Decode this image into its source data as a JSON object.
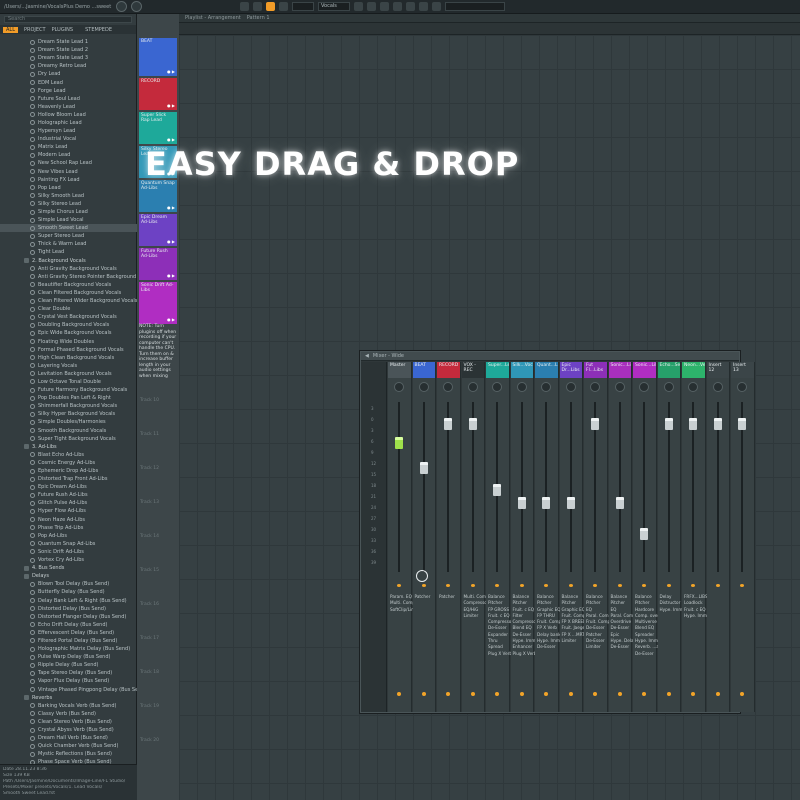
{
  "topbar": {
    "path": "/Users/...Jasmine/VocalsPlus Demo ...sweet Sweet Lead Hit...",
    "pattern_label": "Vocals",
    "accent": "#f29c28"
  },
  "browser": {
    "search_placeholder": "Search",
    "tabs": [
      "ALL",
      "PROJECT",
      "PLUGINS",
      "",
      "STEMPEDE"
    ],
    "items": [
      {
        "label": "Dream State Lead 1",
        "type": "preset"
      },
      {
        "label": "Dream State Lead 2",
        "type": "preset"
      },
      {
        "label": "Dream State Lead 3",
        "type": "preset"
      },
      {
        "label": "Dreamy Retro Lead",
        "type": "preset"
      },
      {
        "label": "Dry Lead",
        "type": "preset"
      },
      {
        "label": "EDM Lead",
        "type": "preset"
      },
      {
        "label": "Forge Lead",
        "type": "preset"
      },
      {
        "label": "Future Soul Lead",
        "type": "preset"
      },
      {
        "label": "Heavenly Lead",
        "type": "preset"
      },
      {
        "label": "Hollow Bloom Lead",
        "type": "preset"
      },
      {
        "label": "Holographic Lead",
        "type": "preset"
      },
      {
        "label": "Hypersyn Lead",
        "type": "preset"
      },
      {
        "label": "Industrial Vocal",
        "type": "preset"
      },
      {
        "label": "Matrix Lead",
        "type": "preset"
      },
      {
        "label": "Modern Lead",
        "type": "preset"
      },
      {
        "label": "New School Rap Lead",
        "type": "preset"
      },
      {
        "label": "New Vibes Lead",
        "type": "preset"
      },
      {
        "label": "Painting FX Lead",
        "type": "preset"
      },
      {
        "label": "Pop Lead",
        "type": "preset"
      },
      {
        "label": "Silky Smooth Lead",
        "type": "preset"
      },
      {
        "label": "Silky Stereo Lead",
        "type": "preset"
      },
      {
        "label": "Simple Chorus Lead",
        "type": "preset"
      },
      {
        "label": "Simple Lead Vocal",
        "type": "preset"
      },
      {
        "label": "Smooth Sweet Lead",
        "type": "preset",
        "selected": true
      },
      {
        "label": "Super Stereo Lead",
        "type": "preset"
      },
      {
        "label": "Thick & Warm Lead",
        "type": "preset"
      },
      {
        "label": "Tight Lead",
        "type": "preset"
      },
      {
        "label": "2. Background Vocals",
        "type": "folder"
      },
      {
        "label": "Anti Gravity Background Vocals",
        "type": "preset"
      },
      {
        "label": "Anti Gravity Stereo Pointer Background Vocals",
        "type": "preset"
      },
      {
        "label": "Beautifier Background Vocals",
        "type": "preset"
      },
      {
        "label": "Clean Filtered Background Vocals",
        "type": "preset"
      },
      {
        "label": "Clean Filtered Wider Background Vocals",
        "type": "preset"
      },
      {
        "label": "Clear Double",
        "type": "preset"
      },
      {
        "label": "Crystal Vest Background Vocals",
        "type": "preset"
      },
      {
        "label": "Doubling Background Vocals",
        "type": "preset"
      },
      {
        "label": "Epic Wide Background Vocals",
        "type": "preset"
      },
      {
        "label": "Floating Wide Doubles",
        "type": "preset"
      },
      {
        "label": "Formal Phased Background Vocals",
        "type": "preset"
      },
      {
        "label": "High Clean Background Vocals",
        "type": "preset"
      },
      {
        "label": "Layering Vocals",
        "type": "preset"
      },
      {
        "label": "Levitation Background Vocals",
        "type": "preset"
      },
      {
        "label": "Low Octave Tonal Double",
        "type": "preset"
      },
      {
        "label": "Future Harmony Background Vocals",
        "type": "preset"
      },
      {
        "label": "Pop Doubles Pan Left & Right",
        "type": "preset"
      },
      {
        "label": "Shimmerfall Background Vocals",
        "type": "preset"
      },
      {
        "label": "Silky Hyper Background Vocals",
        "type": "preset"
      },
      {
        "label": "Simple Doubles/Harmonies",
        "type": "preset"
      },
      {
        "label": "Smooth Background Vocals",
        "type": "preset"
      },
      {
        "label": "Super Tight Background Vocals",
        "type": "preset"
      },
      {
        "label": "3. Ad-Libs",
        "type": "folder"
      },
      {
        "label": "Blast Echo Ad-Libs",
        "type": "preset"
      },
      {
        "label": "Cosmic Energy Ad-Libs",
        "type": "preset"
      },
      {
        "label": "Ephemeric Drop Ad-Libs",
        "type": "preset"
      },
      {
        "label": "Distorted Trap Front Ad-Libs",
        "type": "preset"
      },
      {
        "label": "Epic Dream Ad-Libs",
        "type": "preset"
      },
      {
        "label": "Future Rush Ad-Libs",
        "type": "preset"
      },
      {
        "label": "Glitch Pulse Ad-Libs",
        "type": "preset"
      },
      {
        "label": "Hyper Flow Ad-Libs",
        "type": "preset"
      },
      {
        "label": "Neon Haze Ad-Libs",
        "type": "preset"
      },
      {
        "label": "Phase Trip Ad-Libs",
        "type": "preset"
      },
      {
        "label": "Pop Ad-Libs",
        "type": "preset"
      },
      {
        "label": "Quantum Snap Ad-Libs",
        "type": "preset"
      },
      {
        "label": "Sonic Drift Ad-Libs",
        "type": "preset"
      },
      {
        "label": "Vortex Cry Ad-Libs",
        "type": "preset"
      },
      {
        "label": "4. Bus Sends",
        "type": "folder"
      },
      {
        "label": "Delays",
        "type": "folder"
      },
      {
        "label": "Blown Tool Delay (Bus Send)",
        "type": "preset"
      },
      {
        "label": "Butterfly Delay (Bus Send)",
        "type": "preset"
      },
      {
        "label": "Delay Bank Left & Right (Bus Send)",
        "type": "preset"
      },
      {
        "label": "Distorted Delay (Bus Send)",
        "type": "preset"
      },
      {
        "label": "Distorted Flanger Delay (Bus Send)",
        "type": "preset"
      },
      {
        "label": "Echo Drift Delay (Bus Send)",
        "type": "preset"
      },
      {
        "label": "Effervescent Delay (Bus Send)",
        "type": "preset"
      },
      {
        "label": "Filtered Portal Delay (Bus Send)",
        "type": "preset"
      },
      {
        "label": "Holographic Matrix Delay (Bus Send)",
        "type": "preset"
      },
      {
        "label": "Pulse Warp Delay (Bus Send)",
        "type": "preset"
      },
      {
        "label": "Ripple Delay (Bus Send)",
        "type": "preset"
      },
      {
        "label": "Tape Stereo Delay (Bus Send)",
        "type": "preset"
      },
      {
        "label": "Vapor Flux Delay (Bus Send)",
        "type": "preset"
      },
      {
        "label": "Vintage Phased Pingpong Delay (Bus Send)",
        "type": "preset"
      },
      {
        "label": "Reverbs",
        "type": "folder"
      },
      {
        "label": "Barking Vocals Verb (Bus Send)",
        "type": "preset"
      },
      {
        "label": "Classy Verb (Bus Send)",
        "type": "preset"
      },
      {
        "label": "Clean Stereo Verb (Bus Send)",
        "type": "preset"
      },
      {
        "label": "Crystal Abyss Verb (Bus Send)",
        "type": "preset"
      },
      {
        "label": "Dream Hall Verb (Bus Send)",
        "type": "preset"
      },
      {
        "label": "Quick Chamber Verb (Bus Send)",
        "type": "preset"
      },
      {
        "label": "Mystic Reflections (Bus Send)",
        "type": "preset"
      },
      {
        "label": "Phase Space Verb (Bus Send)",
        "type": "preset"
      }
    ],
    "info": [
      "Date  28.11.23 8:36",
      "Size  139 KB",
      "Path  /Users/Jasmine/Documents/Image-Line/FL Studio/",
      "      Presets/Mixer presets/Vocals/1. Lead Vocals/",
      "      Smooth Sweet Lead.fst"
    ]
  },
  "tracks": {
    "clips": [
      {
        "label": "BEAT",
        "color": "#3a66d1"
      },
      {
        "label": "RECORD",
        "color": "#c42a3c"
      },
      {
        "label": "Super Slick Rap Lead",
        "color": "#1ea99a"
      },
      {
        "label": "Silky Stereo Lead",
        "color": "#2f97b7"
      },
      {
        "label": "Quantum Snap Ad-Libs",
        "color": "#2b7fb0"
      },
      {
        "label": "Epic Dream Ad-Libs",
        "color": "#6d42c4"
      },
      {
        "label": "Future Rush Ad-Libs",
        "color": "#8d2fb8"
      },
      {
        "label": "Sonic Drift Ad-Libs",
        "color": "#b02dc2"
      }
    ],
    "note": "NOTE: Turn plugins off when recording if your computer can't handle the CPU. Turn them on & increase buffer length in your audio settings when mixing",
    "track_labels": [
      "Track 10",
      "Track 11",
      "Track 12",
      "Track 13",
      "Track 14",
      "Track 15",
      "Track 16",
      "Track 17",
      "Track 18",
      "Track 19",
      "Track 20"
    ]
  },
  "playlist": {
    "title": "Playlist - Arrangement",
    "pattern": "Pattern 1"
  },
  "headline": "EASY DRAG & DROP",
  "mixer": {
    "title": "Mixer - Wide",
    "scale": [
      "3",
      "0",
      "3",
      "6",
      "9",
      "12",
      "15",
      "18",
      "21",
      "24",
      "27",
      "30",
      "33",
      "36",
      "39"
    ],
    "strips": [
      {
        "label": "Master",
        "color": "#4a5458",
        "fader": 0.22,
        "fx": "Param. EQ\nMulti. Comp\nSoftClip/Limit",
        "master": true
      },
      {
        "label": "BEAT",
        "color": "#3a66d1",
        "fader": 0.38,
        "fx": "Patcher"
      },
      {
        "label": "RECORD",
        "color": "#c42a3c",
        "fader": 0.1,
        "fx": "Patcher"
      },
      {
        "label": "VOX - REC",
        "color": "#2b3335",
        "fader": 0.1,
        "fx": "Multi. Comp\nCompressor\nEQ/HiG\nLimiter"
      },
      {
        "label": "Super...Lead",
        "color": "#1ea99a",
        "fader": 0.52,
        "fx": "Balance\nPitcher\nFP GROSS\nFruit. c EQ 2\nCompressor\nDe-Esser\nExpander\nThru\nSpread\nPlug X Verb"
      },
      {
        "label": "Silk...Vocals",
        "color": "#2f97b7",
        "fader": 0.6,
        "fx": "Balance\nPitcher\nFruit. c EQ 2\nFilter\nCompressor\nBlend EQ\nDe-Esser\nHype. Imme.\nEnhancer\nPlug X Verb"
      },
      {
        "label": "Quant...Libs",
        "color": "#2b7fb0",
        "fader": 0.6,
        "fx": "Balance\nPitcher\nGraphic EQ\nFP THRU\nFruit. Comp\nFP X Verb\nDelay bank\nHype. Imme.\nDe-Esser"
      },
      {
        "label": "Epic Dr...Libs",
        "color": "#6d42c4",
        "fader": 0.6,
        "fx": "Balance\nPitcher\nGraphic EQ\nFruit. Comp\nFP X BREED\nFruit. Jaeger\nFP X ...MRTR\nLimiter"
      },
      {
        "label": "Fut Fl...Libs",
        "color": "#8d2fb8",
        "fader": 0.1,
        "fx": "Balance\nPitcher\nEQ\nParal. Comp\nFruit. Comp\nDe-Esser\nPatcher\nDe-Esser\nLimiter"
      },
      {
        "label": "Sonic...Libs",
        "color": "#a92fbd",
        "fader": 0.6,
        "fx": "Balance\nPitcher\nEQ\nParal. Comp\nOverdrive\nDe-Esser\nEpic\nHype. Delay\nDe-Esser"
      },
      {
        "label": "Sonic...Libs",
        "color": "#b02dc2",
        "fader": 0.8,
        "fx": "Balance\nPitcher\nHardcore\nComp. over\nMultiverse\nBlend EQ\nSpreader\nHype. Imme.\nReverb. ...alt\nDe-Esser"
      },
      {
        "label": "Echo...Send",
        "color": "#26a06a",
        "fader": 0.1,
        "fx": "Delay\nDistructor\nHype. Imme."
      },
      {
        "label": "Neon...Verb",
        "color": "#2db36b",
        "fader": 0.1,
        "fx": "FRFX...LIBS\nLoadlock\nFruit. c EQ 2\nHype. Imme."
      },
      {
        "label": "Insert 12",
        "color": "#3b4548",
        "fader": 0.1,
        "fx": ""
      },
      {
        "label": "Insert 13",
        "color": "#3b4548",
        "fader": 0.1,
        "fx": ""
      }
    ]
  }
}
